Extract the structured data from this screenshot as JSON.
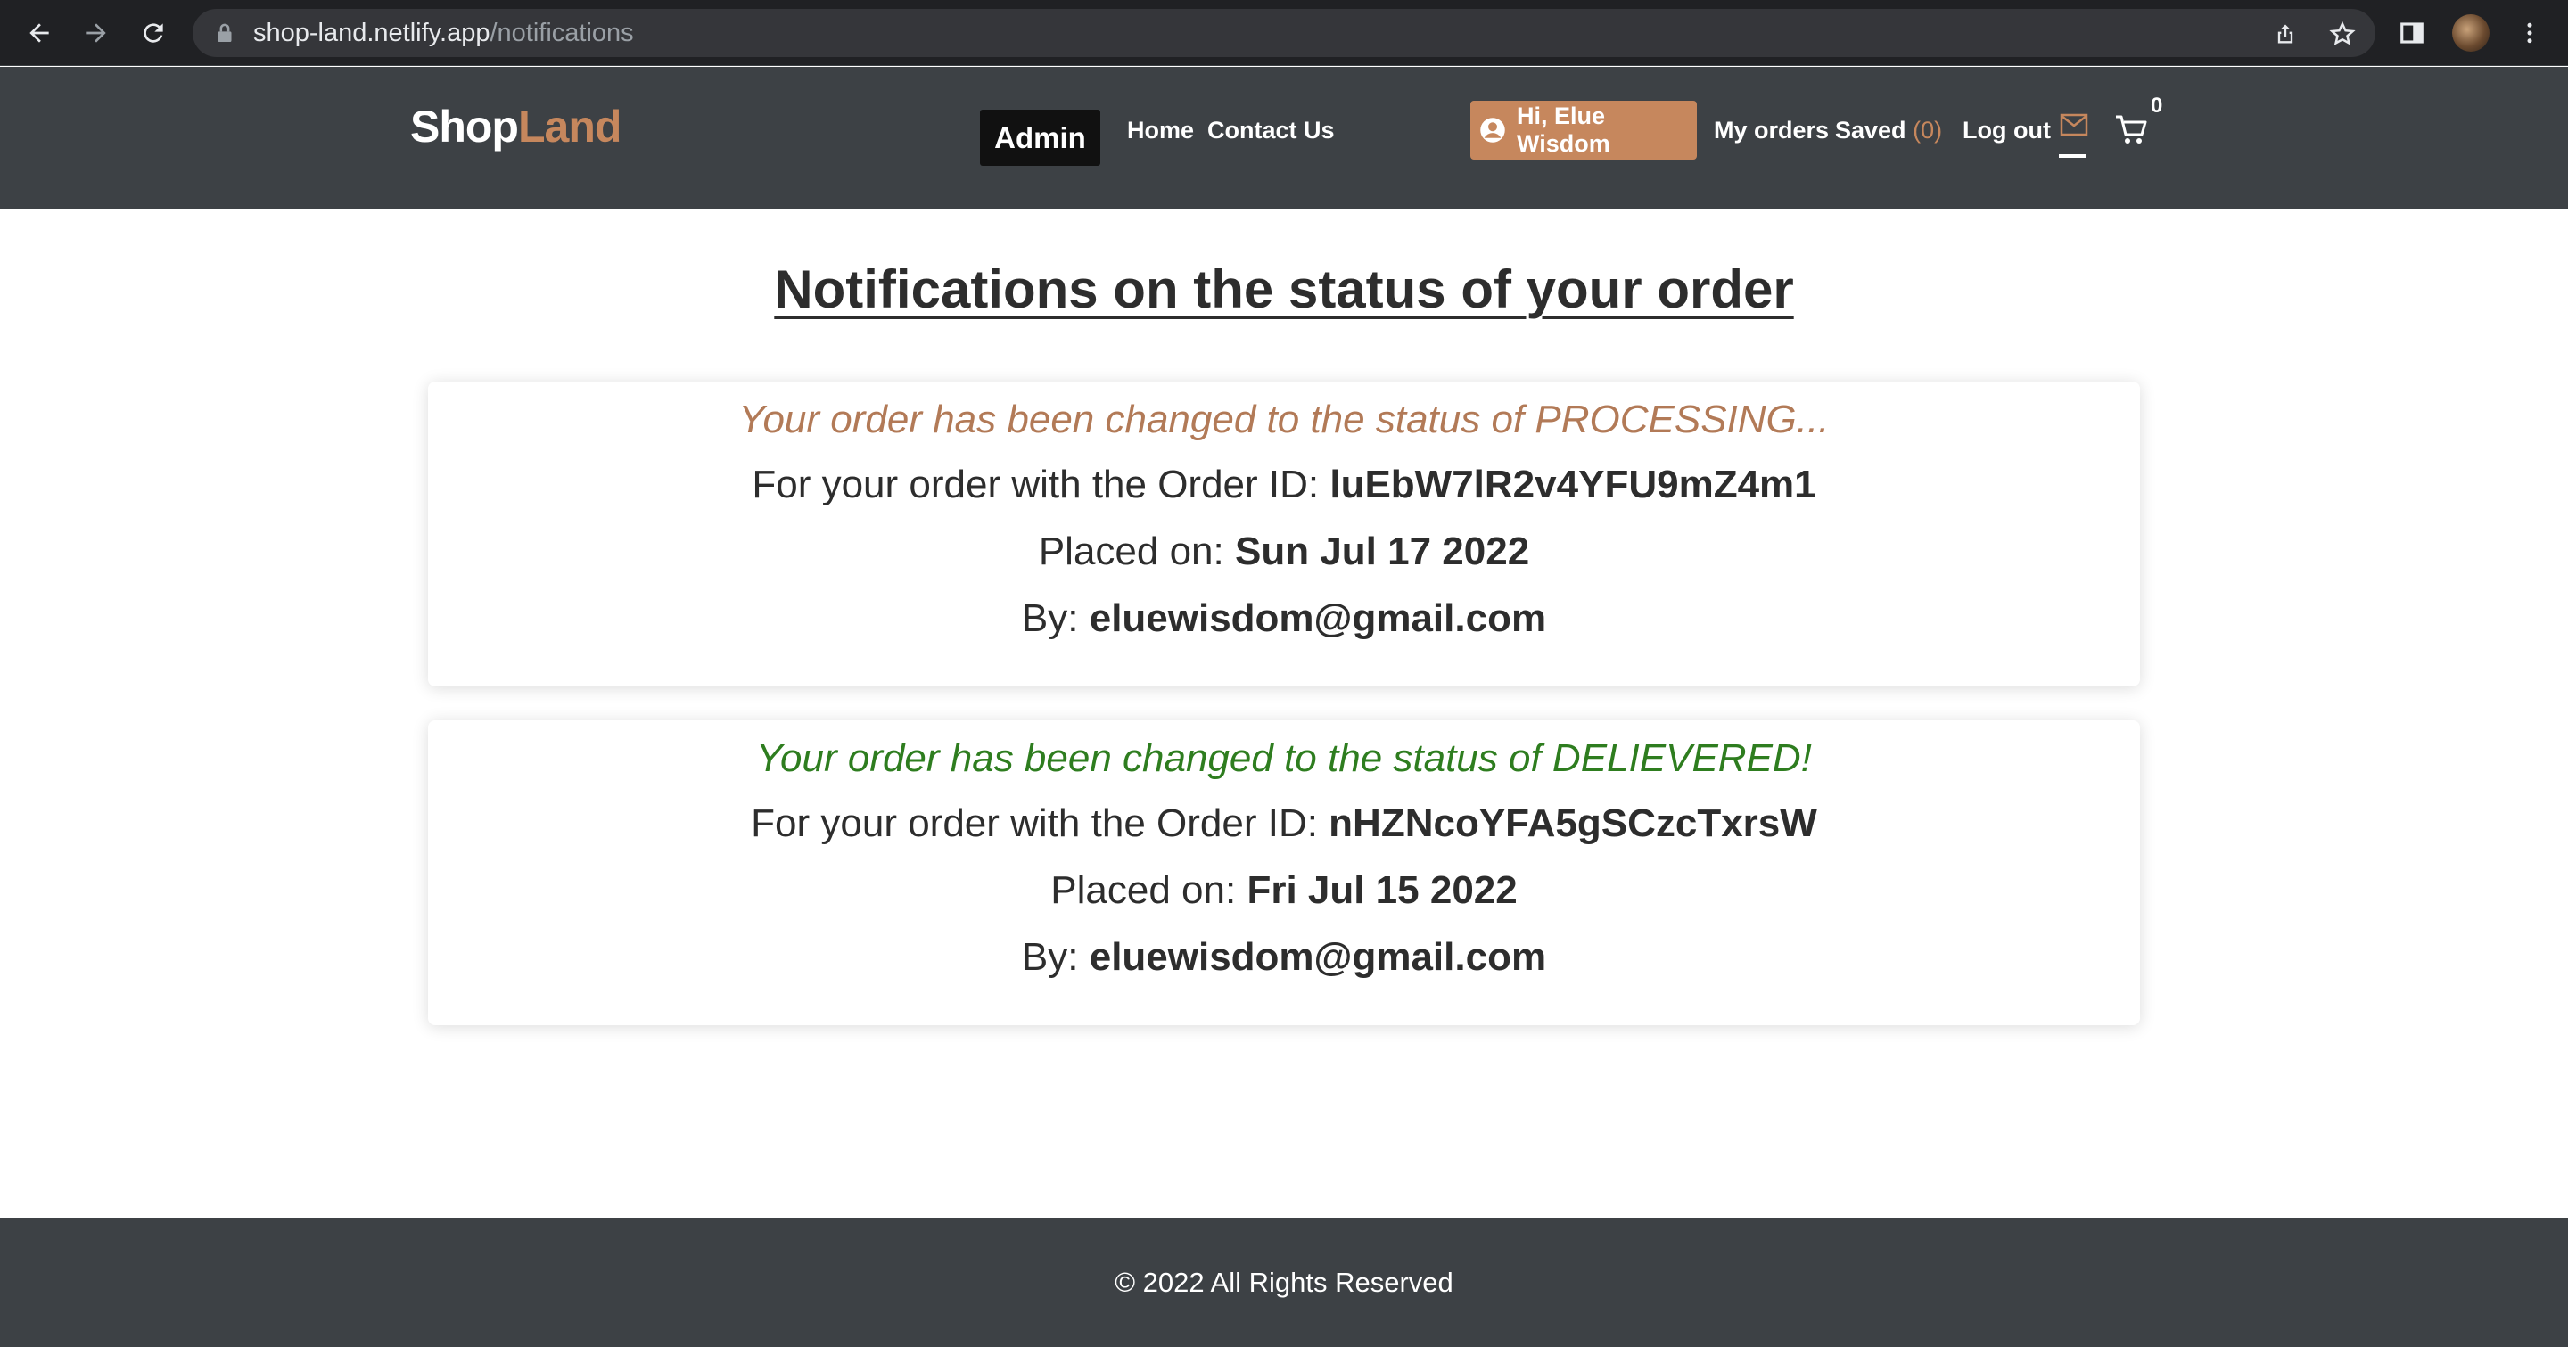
{
  "browser": {
    "url_host": "shop-land.netlify.app",
    "url_path": "/notifications"
  },
  "header": {
    "logo_part1": "Shop",
    "logo_part2": "Land",
    "admin_label": "Admin",
    "nav": {
      "home": "Home",
      "contact": "Contact Us"
    },
    "greeting": "Hi, Elue Wisdom",
    "my_orders": "My orders",
    "saved_label": "Saved",
    "saved_count": "(0)",
    "logout": "Log out",
    "cart_count": "0"
  },
  "main": {
    "title": "Notifications on the status of your order",
    "notifications": [
      {
        "status_text": "Your order has been changed to the status of PROCESSING...",
        "order_prefix": "For your order with the Order ID:",
        "order_id": "luEbW7lR2v4YFU9mZ4m1",
        "placed_prefix": "Placed on:",
        "placed_date": "Sun Jul 17 2022",
        "by_prefix": "By:",
        "by_email": "eluewisdom@gmail.com"
      },
      {
        "status_text": "Your order has been changed to the status of DELIEVERED!",
        "order_prefix": "For your order with the Order ID:",
        "order_id": "nHZNcoYFA5gSCzcTxrsW",
        "placed_prefix": "Placed on:",
        "placed_date": "Fri Jul 15 2022",
        "by_prefix": "By:",
        "by_email": "eluewisdom@gmail.com"
      }
    ]
  },
  "footer": {
    "copyright": "© 2022 All Rights Reserved"
  },
  "colors": {
    "brand_accent": "#c6875d",
    "header_bg": "#3d4145",
    "processing": "#b27a57",
    "delivered": "#2e7d1f"
  }
}
